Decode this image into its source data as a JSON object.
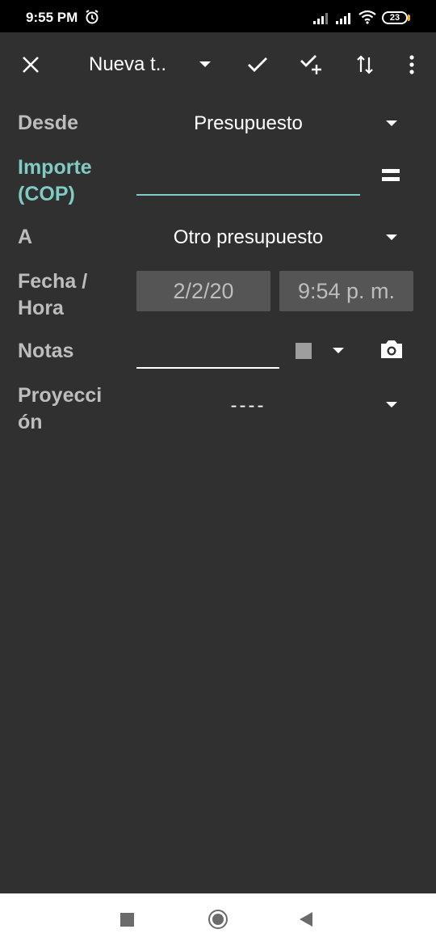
{
  "status": {
    "time": "9:55 PM",
    "battery": "23"
  },
  "toolbar": {
    "title": "Nueva t..",
    "icons": [
      "close-icon",
      "chevron-down-icon",
      "check-icon",
      "check-plus-icon",
      "swap-vertical-icon",
      "more-vert-icon"
    ]
  },
  "form": {
    "from_label": "Desde",
    "from_value": "Presupuesto",
    "amount_label_line1": "Importe",
    "amount_label_line2": "(COP)",
    "amount_value": "",
    "to_label": "A",
    "to_value": "Otro presupuesto",
    "datetime_label_line1": "Fecha /",
    "datetime_label_line2": "Hora",
    "date_value": "2/2/20",
    "time_value": "9:54 p. m.",
    "notes_label": "Notas",
    "notes_value": "",
    "projection_label_line1": "Proyecci",
    "projection_label_line2": "ón",
    "projection_value": "----"
  },
  "colors": {
    "background": "#303030",
    "accent": "#80cbc4",
    "label": "#bdbdbd"
  }
}
